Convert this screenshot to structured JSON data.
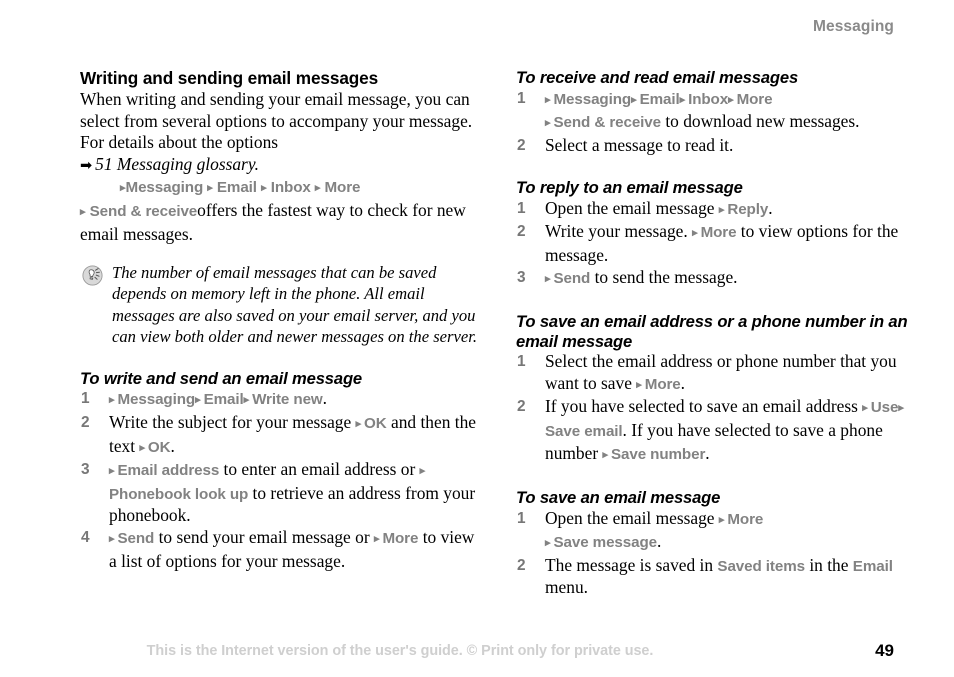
{
  "header": {
    "running_head": "Messaging"
  },
  "footer": {
    "notice": "This is the Internet version of the user's guide. © Print only for private use.",
    "page_number": "49"
  },
  "left_column": {
    "section_title": "Writing and sending email messages",
    "intro_paragraph": "When writing and sending your email message, you can select from several options to accompany your message. For details about the options",
    "crossref_arrow": "➡",
    "crossref_text": "51 Messaging glossary.",
    "path_line": {
      "arrow": "▸",
      "item1": "Messaging",
      "item2": "Email",
      "item3": "Inbox",
      "item4": "More"
    },
    "send_receive_line": {
      "arrow": "▸",
      "ui_term": "Send & receive",
      "text_after": "offers the fastest way to check for new email messages."
    },
    "note": {
      "icon": "tip-bulb-icon",
      "text": "The number of email messages that can be saved depends on memory left in the phone. All email messages are also saved on your email server, and you can view both older and newer messages on the server."
    },
    "procedure": {
      "title": "To write and send an email message",
      "steps": [
        {
          "num": "1",
          "parts": [
            {
              "t": "ui-arrow",
              "v": "▸"
            },
            {
              "t": "ui",
              "v": "Messaging"
            },
            {
              "t": "ui-arrow",
              "v": "▸"
            },
            {
              "t": "ui",
              "v": "Email"
            },
            {
              "t": "ui-arrow",
              "v": "▸"
            },
            {
              "t": "ui",
              "v": "Write new"
            },
            {
              "t": "plain",
              "v": "."
            }
          ]
        },
        {
          "num": "2",
          "parts": [
            {
              "t": "plain",
              "v": "Write the subject for your message "
            },
            {
              "t": "ui-arrow",
              "v": "▸"
            },
            {
              "t": "ui",
              "v": "OK"
            },
            {
              "t": "plain",
              "v": " and then the text "
            },
            {
              "t": "ui-arrow",
              "v": "▸"
            },
            {
              "t": "ui",
              "v": "OK"
            },
            {
              "t": "plain",
              "v": "."
            }
          ]
        },
        {
          "num": "3",
          "parts": [
            {
              "t": "ui-arrow",
              "v": "▸"
            },
            {
              "t": "ui",
              "v": "Email address"
            },
            {
              "t": "plain",
              "v": " to enter an email address or "
            },
            {
              "t": "ui-arrow",
              "v": "▸"
            },
            {
              "t": "ui",
              "v": "Phonebook look up"
            },
            {
              "t": "plain",
              "v": " to retrieve an address from your phonebook."
            }
          ]
        },
        {
          "num": "4",
          "parts": [
            {
              "t": "ui-arrow",
              "v": "▸"
            },
            {
              "t": "ui",
              "v": "Send"
            },
            {
              "t": "plain",
              "v": " to send your email message or "
            },
            {
              "t": "ui-arrow",
              "v": "▸"
            },
            {
              "t": "ui",
              "v": "More"
            },
            {
              "t": "plain",
              "v": " to view a list of options for your message."
            }
          ]
        }
      ]
    }
  },
  "right_column": {
    "procedures": [
      {
        "title": "To receive and read email messages",
        "steps": [
          {
            "num": "1",
            "lines": [
              [
                {
                  "t": "ui-arrow",
                  "v": "▸"
                },
                {
                  "t": "ui",
                  "v": "Messaging"
                },
                {
                  "t": "ui-arrow",
                  "v": "▸"
                },
                {
                  "t": "ui",
                  "v": "Email"
                },
                {
                  "t": "ui-arrow",
                  "v": "▸"
                },
                {
                  "t": "ui",
                  "v": "Inbox"
                },
                {
                  "t": "ui-arrow",
                  "v": "▸"
                },
                {
                  "t": "ui",
                  "v": "More"
                }
              ],
              [
                {
                  "t": "ui-arrow",
                  "v": "▸"
                },
                {
                  "t": "ui",
                  "v": "Send & receive"
                },
                {
                  "t": "plain",
                  "v": " to download new messages."
                }
              ]
            ]
          },
          {
            "num": "2",
            "lines": [
              [
                {
                  "t": "plain",
                  "v": "Select a message to read it."
                }
              ]
            ]
          }
        ]
      },
      {
        "title": "To reply to an email message",
        "steps": [
          {
            "num": "1",
            "lines": [
              [
                {
                  "t": "plain",
                  "v": "Open the email message "
                },
                {
                  "t": "ui-arrow",
                  "v": "▸"
                },
                {
                  "t": "ui",
                  "v": "Reply"
                },
                {
                  "t": "plain",
                  "v": "."
                }
              ]
            ]
          },
          {
            "num": "2",
            "lines": [
              [
                {
                  "t": "plain",
                  "v": "Write your message. "
                },
                {
                  "t": "ui-arrow",
                  "v": "▸"
                },
                {
                  "t": "ui",
                  "v": "More"
                },
                {
                  "t": "plain",
                  "v": " to view options for the message."
                }
              ]
            ]
          },
          {
            "num": "3",
            "lines": [
              [
                {
                  "t": "ui-arrow",
                  "v": "▸"
                },
                {
                  "t": "ui",
                  "v": "Send"
                },
                {
                  "t": "plain",
                  "v": " to send the message."
                }
              ]
            ]
          }
        ]
      },
      {
        "title": "To save an email address or a phone number in an email message",
        "steps": [
          {
            "num": "1",
            "lines": [
              [
                {
                  "t": "plain",
                  "v": "Select the email address or phone number that you want to save "
                },
                {
                  "t": "ui-arrow",
                  "v": "▸"
                },
                {
                  "t": "ui",
                  "v": "More"
                },
                {
                  "t": "plain",
                  "v": "."
                }
              ]
            ]
          },
          {
            "num": "2",
            "lines": [
              [
                {
                  "t": "plain",
                  "v": "If you have selected to save an email address "
                },
                {
                  "t": "ui-arrow",
                  "v": "▸"
                },
                {
                  "t": "ui",
                  "v": "Use"
                },
                {
                  "t": "ui-arrow",
                  "v": "▸"
                },
                {
                  "t": "ui",
                  "v": "Save email"
                },
                {
                  "t": "plain",
                  "v": ". If you have selected to save a phone number "
                },
                {
                  "t": "ui-arrow",
                  "v": "▸"
                },
                {
                  "t": "ui",
                  "v": "Save number"
                },
                {
                  "t": "plain",
                  "v": "."
                }
              ]
            ]
          }
        ]
      },
      {
        "title": "To save an email message",
        "steps": [
          {
            "num": "1",
            "lines": [
              [
                {
                  "t": "plain",
                  "v": "Open the email message "
                },
                {
                  "t": "ui-arrow",
                  "v": "▸"
                },
                {
                  "t": "ui",
                  "v": "More"
                }
              ],
              [
                {
                  "t": "ui-arrow",
                  "v": "▸"
                },
                {
                  "t": "ui",
                  "v": "Save message"
                },
                {
                  "t": "plain",
                  "v": "."
                }
              ]
            ]
          },
          {
            "num": "2",
            "lines": [
              [
                {
                  "t": "plain",
                  "v": "The message is saved in "
                },
                {
                  "t": "ui",
                  "v": "Saved items"
                },
                {
                  "t": "plain",
                  "v": " in the "
                },
                {
                  "t": "ui",
                  "v": "Email"
                },
                {
                  "t": "plain",
                  "v": " menu."
                }
              ]
            ]
          }
        ]
      }
    ]
  },
  "colors": {
    "ui_term_gray": "#828282",
    "running_head_gray": "#8a8a8a",
    "footer_gray": "#cfcfcf",
    "step_number_gray": "#777777",
    "text_black": "#000000"
  }
}
